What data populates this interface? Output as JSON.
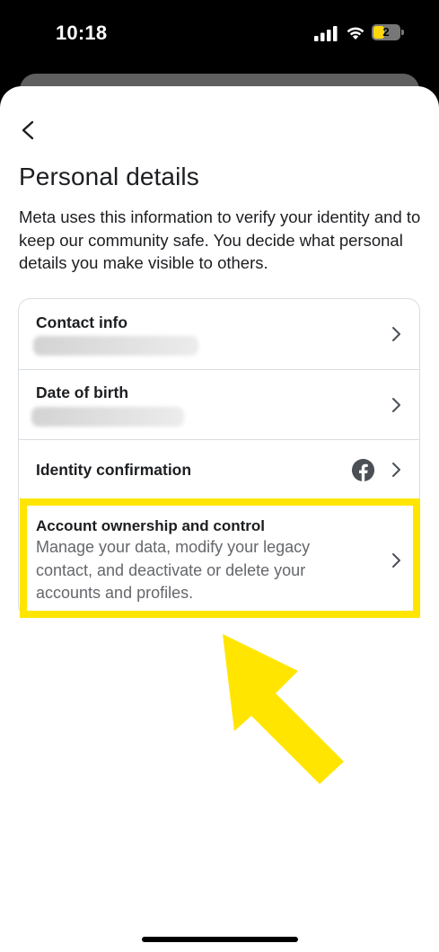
{
  "status_bar": {
    "time": "10:18",
    "battery_level": "2"
  },
  "page": {
    "title": "Personal details",
    "description": "Meta uses this information to verify your identity and to keep our community safe. You decide what personal details you make visible to others."
  },
  "items": [
    {
      "title": "Contact info"
    },
    {
      "title": "Date of birth"
    },
    {
      "title": "Identity confirmation",
      "icon": "facebook-icon"
    },
    {
      "title": "Account ownership and control",
      "subtitle": "Manage your data, modify your legacy contact, and deactivate or delete your accounts and profiles."
    }
  ],
  "colors": {
    "highlight": "#ffe500",
    "text": "#1c1e21",
    "secondary_text": "#65676b"
  }
}
